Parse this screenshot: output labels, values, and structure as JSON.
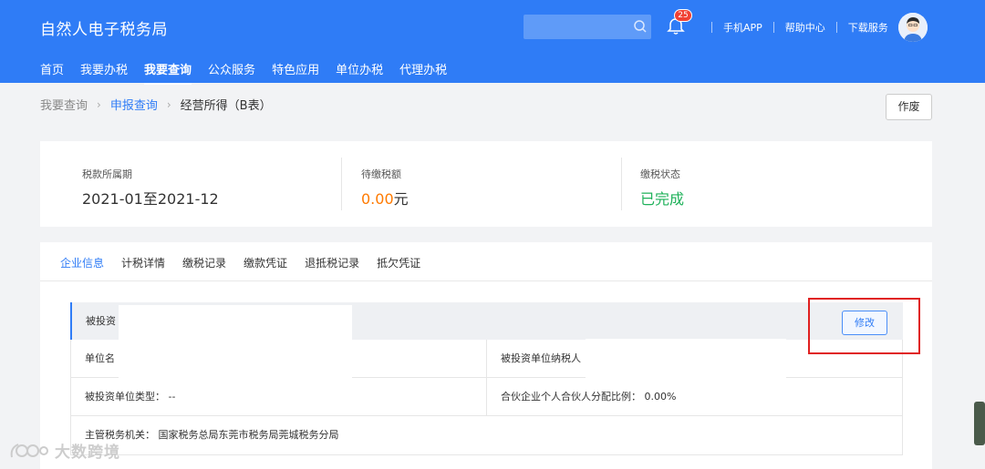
{
  "header": {
    "site_title": "自然人电子税务局",
    "search_placeholder": "",
    "notification_count": "25",
    "links": [
      "手机APP",
      "帮助中心",
      "下载服务"
    ],
    "brand_color": "#2f7cf6"
  },
  "nav": {
    "items": [
      "首页",
      "我要办税",
      "我要查询",
      "公众服务",
      "特色应用",
      "单位办税",
      "代理办税"
    ],
    "active": "我要查询"
  },
  "breadcrumb": {
    "root": "我要查询",
    "link": "申报查询",
    "current": "经营所得（B表）"
  },
  "actions": {
    "void_label": "作废"
  },
  "summary": {
    "period_label": "税款所属期",
    "period_value": "2021-01至2021-12",
    "due_label": "待缴税额",
    "due_amount": "0.00",
    "due_unit": "元",
    "status_label": "缴税状态",
    "status_value": "已完成"
  },
  "tabs": {
    "items": [
      "企业信息",
      "计税详情",
      "缴税记录",
      "缴款凭证",
      "退抵税记录",
      "抵欠凭证"
    ],
    "active": "企业信息"
  },
  "section": {
    "title": "被投资",
    "edit_label": "修改",
    "rows": {
      "unit_name_label": "单位名",
      "taxpayer_label": "被投资单位纳税人",
      "unit_type": "被投资单位类型：  --",
      "ratio": "合伙企业个人合伙人分配比例：  0.00%",
      "authority": "主管税务机关：  国家税务总局东莞市税务局莞城税务分局"
    }
  },
  "watermark": "大数跨境"
}
